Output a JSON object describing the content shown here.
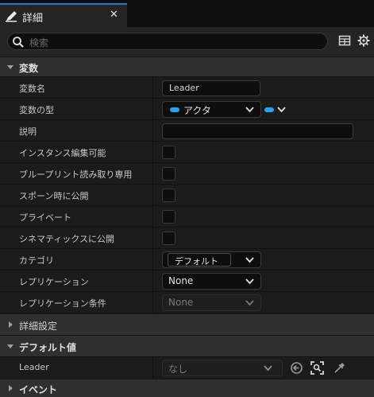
{
  "tab": {
    "title": "詳細"
  },
  "search": {
    "placeholder": "検索"
  },
  "sections": {
    "variables": "変数",
    "advanced": "詳細設定",
    "default_value": "デフォルト値",
    "events": "イベント"
  },
  "rows": {
    "var_name": {
      "label": "変数名",
      "value": "Leader"
    },
    "var_type": {
      "label": "変数の型",
      "value": "アクタ"
    },
    "description": {
      "label": "説明",
      "value": ""
    },
    "instance_editable": {
      "label": "インスタンス編集可能"
    },
    "blueprint_readonly": {
      "label": "ブループリント読み取り専用"
    },
    "expose_on_spawn": {
      "label": "スポーン時に公開"
    },
    "private": {
      "label": "プライベート"
    },
    "expose_cinematics": {
      "label": "シネマティックスに公開"
    },
    "category": {
      "label": "カテゴリ",
      "value": "デフォルト"
    },
    "replication": {
      "label": "レプリケーション",
      "value": "None"
    },
    "replication_condition": {
      "label": "レプリケーション条件",
      "value": "None"
    },
    "leader_default": {
      "label": "Leader",
      "value": "なし"
    }
  },
  "colors": {
    "accent": "#2a72d4",
    "type_pill": "#20a7ef"
  },
  "icons": [
    "pencil-icon",
    "close-icon",
    "search-icon",
    "grid-icon",
    "gear-icon",
    "chevron-down-icon",
    "caret-down-icon",
    "caret-right-icon",
    "use-selected-icon",
    "browse-icon",
    "eyedropper-icon"
  ]
}
